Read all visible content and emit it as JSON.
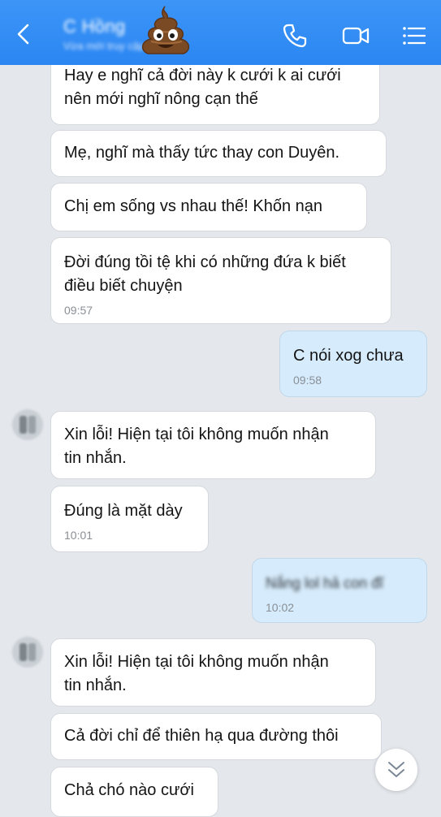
{
  "header": {
    "contact_name": "C Hồng",
    "status_text": "Vừa mới truy cập",
    "emoji": "poop",
    "icons": [
      "back-arrow-icon",
      "phone-icon",
      "video-call-icon",
      "menu-icon"
    ],
    "accent": "#2d8cf5"
  },
  "messages": [
    {
      "side": "them",
      "lines": [
        "Hay e nghĩ cả đời này k cưới k ai cưới",
        "nên mới nghĩ nông cạn thế"
      ],
      "time": ""
    },
    {
      "side": "them",
      "lines": [
        "Mẹ, nghĩ mà thấy tức thay con Duyên."
      ],
      "time": ""
    },
    {
      "side": "them",
      "lines": [
        "Chị em sống vs nhau thế! Khốn nạn"
      ],
      "time": ""
    },
    {
      "side": "them",
      "lines": [
        "Đời đúng tồi tệ khi có những đứa k biết",
        "điều biết chuyện"
      ],
      "time": "09:57"
    },
    {
      "side": "me",
      "lines": [
        "C nói xog chưa"
      ],
      "time": "09:58"
    },
    {
      "side": "them",
      "lines": [
        "Xin lỗi! Hiện tại tôi không muốn nhận",
        "tin nhắn."
      ],
      "time": ""
    },
    {
      "side": "them",
      "lines": [
        "Đúng là mặt dày"
      ],
      "time": "10:01"
    },
    {
      "side": "me",
      "lines": [
        "Nắng lol hả con đĩ"
      ],
      "time": "10:02"
    },
    {
      "side": "them",
      "lines": [
        "Xin lỗi! Hiện tại tôi không muốn nhận",
        "tin nhắn."
      ],
      "time": ""
    },
    {
      "side": "them",
      "lines": [
        "Cả đời chỉ để thiên hạ qua đường thôi"
      ],
      "time": ""
    },
    {
      "side": "them",
      "lines": [
        "Chả chó nào cưới"
      ],
      "time": ""
    }
  ],
  "scroll_button": {
    "icon": "double-chevron-down-icon"
  }
}
